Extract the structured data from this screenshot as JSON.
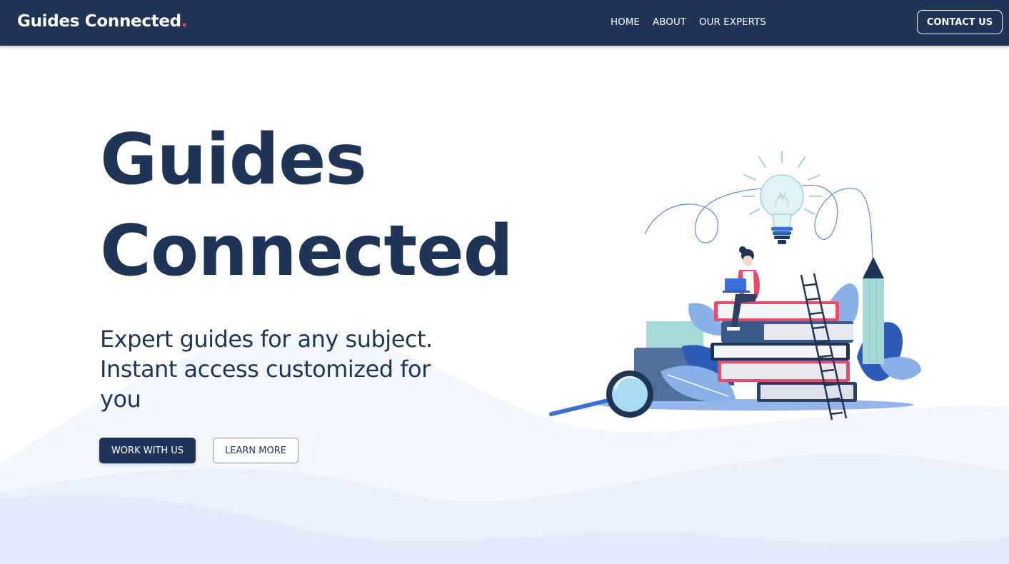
{
  "header": {
    "brand": "Guides Connected",
    "brand_dot": ".",
    "nav": [
      "HOME",
      "ABOUT",
      "OUR EXPERTS"
    ],
    "contact_label": "CONTACT US"
  },
  "hero": {
    "title_line1": "Guides",
    "title_line2": "Connected",
    "subtitle": "Expert guides for any subject. Instant access customized for you",
    "primary_button": "WORK WITH US",
    "secondary_button": "LEARN MORE"
  },
  "colors": {
    "navy": "#1f3557",
    "accent_red": "#e84a6a",
    "wave_light": "#eef3fc",
    "blue": "#3a6fd8"
  },
  "icons": [
    "lightbulb-icon",
    "magnifying-glass-icon",
    "laptop-icon",
    "pencil-icon",
    "ladder-icon"
  ]
}
